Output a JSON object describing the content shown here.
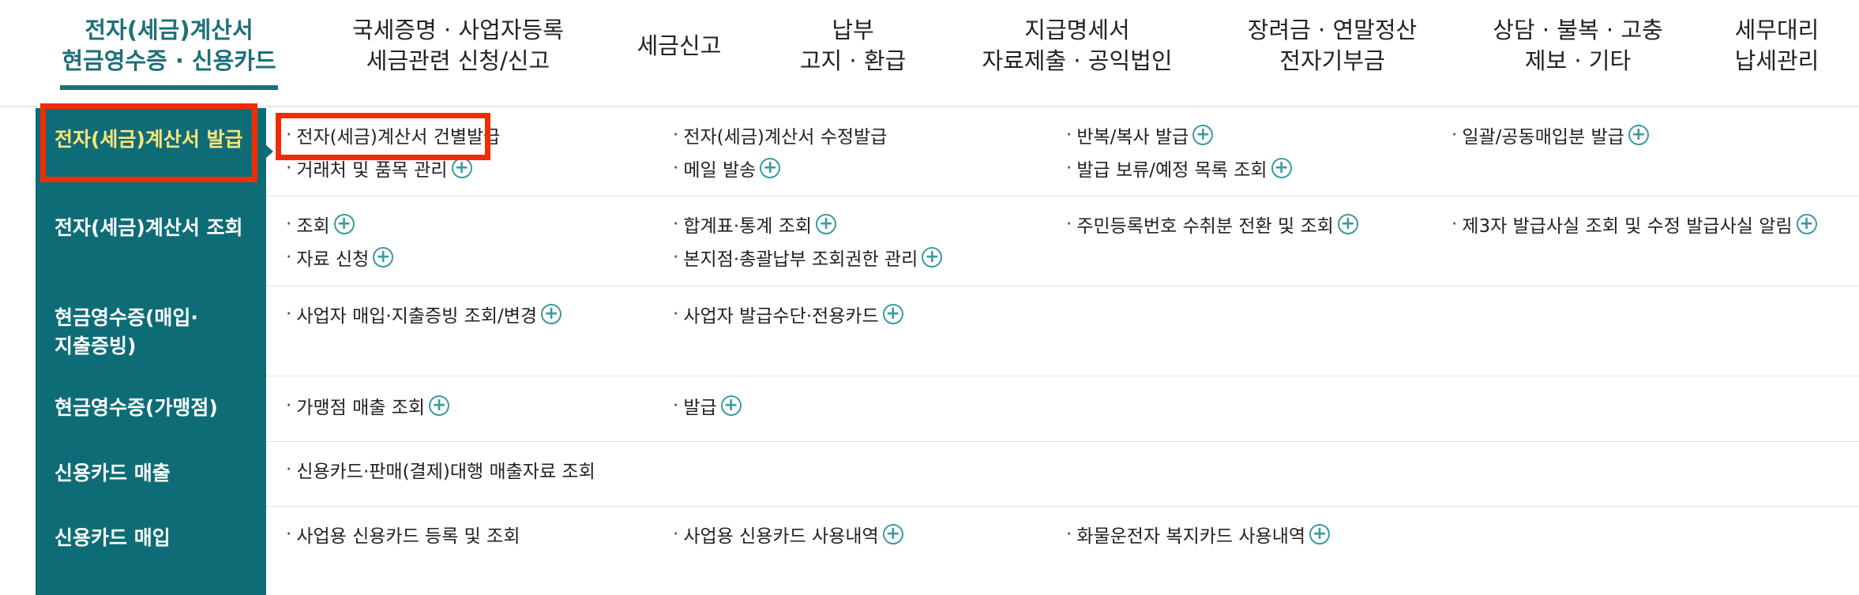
{
  "topnav": [
    {
      "lines": [
        "전자(세금)계산서",
        "현금영수증 · 신용카드"
      ],
      "active": true
    },
    {
      "lines": [
        "국세증명 · 사업자등록",
        "세금관련 신청/신고"
      ]
    },
    {
      "lines": [
        "세금신고"
      ]
    },
    {
      "lines": [
        "납부",
        "고지 · 환급"
      ]
    },
    {
      "lines": [
        "지급명세서",
        "자료제출 · 공익법인"
      ]
    },
    {
      "lines": [
        "장려금 · 연말정산",
        "전자기부금"
      ]
    },
    {
      "lines": [
        "상담 · 불복 · 고충",
        "제보 · 기타"
      ]
    },
    {
      "lines": [
        "세무대리",
        "납세관리"
      ]
    }
  ],
  "sidebar": [
    {
      "label": "전자(세금)계산서 발급",
      "active": true
    },
    {
      "label": "전자(세금)계산서 조회"
    },
    {
      "label": "현금영수증(매입·지출증빙)"
    },
    {
      "label": "현금영수증(가맹점)"
    },
    {
      "label": "신용카드 매출"
    },
    {
      "label": "신용카드 매입"
    }
  ],
  "submenu": {
    "issue": [
      {
        "label": "전자(세금)계산서 건별발급",
        "plus": false
      },
      {
        "label": "전자(세금)계산서 수정발급",
        "plus": false
      },
      {
        "label": "반복/복사 발급",
        "plus": true
      },
      {
        "label": "일괄/공동매입분 발급",
        "plus": true
      },
      {
        "label": "거래처 및 품목 관리",
        "plus": true
      },
      {
        "label": "메일 발송",
        "plus": true
      },
      {
        "label": "발급 보류/예정 목록 조회",
        "plus": true
      }
    ],
    "inquiry": [
      {
        "label": "조회",
        "plus": true
      },
      {
        "label": "합계표·통계 조회",
        "plus": true
      },
      {
        "label": "주민등록번호 수취분 전환 및 조회",
        "plus": true
      },
      {
        "label": "제3자 발급사실 조회 및 수정 발급사실 알림",
        "plus": true
      },
      {
        "label": "자료 신청",
        "plus": true
      },
      {
        "label": "본지점·총괄납부 조회권한 관리",
        "plus": true
      }
    ],
    "cash_purchase": [
      {
        "label": "사업자 매입·지출증빙 조회/변경",
        "plus": true
      },
      {
        "label": "사업자 발급수단·전용카드",
        "plus": true
      }
    ],
    "cash_merchant": [
      {
        "label": "가맹점 매출 조회",
        "plus": true
      },
      {
        "label": "발급",
        "plus": true
      }
    ],
    "card_sales": [
      {
        "label": "신용카드·판매(결제)대행 매출자료 조회",
        "plus": false
      }
    ],
    "card_purchase": [
      {
        "label": "사업용 신용카드 등록 및 조회",
        "plus": false
      },
      {
        "label": "사업용 신용카드 사용내역",
        "plus": true
      },
      {
        "label": "화물운전자 복지카드 사용내역",
        "plus": true
      }
    ]
  },
  "icons": {
    "plus": "+",
    "bullet": "·"
  },
  "colors": {
    "accent": "#1d7079",
    "sidebar": "#0e6c77",
    "highlight": "#f42b00",
    "sidebar_active_text": "#ffe27a"
  }
}
